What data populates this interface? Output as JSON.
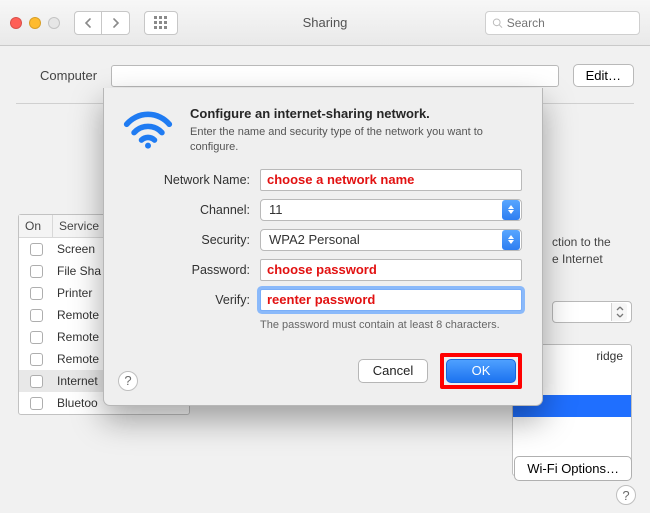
{
  "window": {
    "title": "Sharing",
    "search_placeholder": "Search",
    "back_icon": "chevron-left-icon",
    "fwd_icon": "chevron-right-icon",
    "grid_icon": "grid-icon"
  },
  "background": {
    "computer_label": "Computer",
    "edit_label": "Edit…",
    "services_header_on": "On",
    "services_header_service": "Service",
    "services": [
      {
        "label": "Screen"
      },
      {
        "label": "File Sha"
      },
      {
        "label": "Printer"
      },
      {
        "label": "Remote"
      },
      {
        "label": "Remote"
      },
      {
        "label": "Remote"
      },
      {
        "label": "Internet",
        "selected": true
      },
      {
        "label": "Bluetoo"
      }
    ],
    "right_text_1": "ction to the",
    "right_text_2": "e Internet",
    "port_item": "ridge",
    "wifi_options": "Wi-Fi Options…"
  },
  "sheet": {
    "title": "Configure an internet-sharing network.",
    "subtitle": "Enter the name and security type of the network you want to configure.",
    "labels": {
      "network_name": "Network Name:",
      "channel": "Channel:",
      "security": "Security:",
      "password": "Password:",
      "verify": "Verify:"
    },
    "values": {
      "network_name": "choose a network name",
      "channel": "11",
      "security": "WPA2 Personal",
      "password": "choose password",
      "verify": "reenter password"
    },
    "hint": "The password must contain at least 8 characters.",
    "cancel": "Cancel",
    "ok": "OK",
    "help": "?"
  },
  "help": "?"
}
